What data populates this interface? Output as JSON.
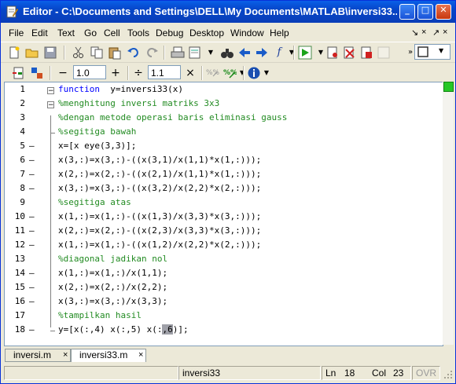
{
  "window": {
    "title": "Editor - C:\\Documents and Settings\\DELL\\My Documents\\MATLAB\\inversi33...",
    "minimize_glyph": "_",
    "maximize_glyph": "□",
    "close_glyph": "✕"
  },
  "menubar": {
    "items": [
      "File",
      "Edit",
      "Text",
      "Go",
      "Cell",
      "Tools",
      "Debug",
      "Desktop",
      "Window",
      "Help"
    ],
    "right_icons": [
      "↘",
      "×",
      "↗",
      "×"
    ]
  },
  "toolbar2": {
    "minus": "−",
    "plus": "+",
    "divide": "÷",
    "times": "×",
    "input1": "1.0",
    "input2": "1.1"
  },
  "code": {
    "lines": [
      {
        "n": "1",
        "dash": "",
        "parts": [
          [
            "kw",
            "function"
          ],
          [
            "",
            "  y=inversi33(x)"
          ]
        ]
      },
      {
        "n": "2",
        "dash": "",
        "parts": [
          [
            "cm",
            "%menghitung inversi matriks 3x3"
          ]
        ]
      },
      {
        "n": "3",
        "dash": "",
        "parts": [
          [
            "cm",
            "%dengan metode operasi baris eliminasi gauss"
          ]
        ]
      },
      {
        "n": "4",
        "dash": "",
        "parts": [
          [
            "cm",
            "%segitiga bawah"
          ]
        ]
      },
      {
        "n": "5",
        "dash": "–",
        "parts": [
          [
            "",
            "x=[x eye(3,3)];"
          ]
        ]
      },
      {
        "n": "6",
        "dash": "–",
        "parts": [
          [
            "",
            "x(3,:)=x(3,:)-((x(3,1)/x(1,1)*x(1,:)));"
          ]
        ]
      },
      {
        "n": "7",
        "dash": "–",
        "parts": [
          [
            "",
            "x(2,:)=x(2,:)-((x(2,1)/x(1,1)*x(1,:)));"
          ]
        ]
      },
      {
        "n": "8",
        "dash": "–",
        "parts": [
          [
            "",
            "x(3,:)=x(3,:)-((x(3,2)/x(2,2)*x(2,:)));"
          ]
        ]
      },
      {
        "n": "9",
        "dash": "",
        "parts": [
          [
            "cm",
            "%segitiga atas"
          ]
        ]
      },
      {
        "n": "10",
        "dash": "–",
        "parts": [
          [
            "",
            "x(1,:)=x(1,:)-((x(1,3)/x(3,3)*x(3,:)));"
          ]
        ]
      },
      {
        "n": "11",
        "dash": "–",
        "parts": [
          [
            "",
            "x(2,:)=x(2,:)-((x(2,3)/x(3,3)*x(3,:)));"
          ]
        ]
      },
      {
        "n": "12",
        "dash": "–",
        "parts": [
          [
            "",
            "x(1,:)=x(1,:)-((x(1,2)/x(2,2)*x(2,:)));"
          ]
        ]
      },
      {
        "n": "13",
        "dash": "",
        "parts": [
          [
            "cm",
            "%diagonal jadikan nol"
          ]
        ]
      },
      {
        "n": "14",
        "dash": "–",
        "parts": [
          [
            "",
            "x(1,:)=x(1,:)/x(1,1);"
          ]
        ]
      },
      {
        "n": "15",
        "dash": "–",
        "parts": [
          [
            "",
            "x(2,:)=x(2,:)/x(2,2);"
          ]
        ]
      },
      {
        "n": "16",
        "dash": "–",
        "parts": [
          [
            "",
            "x(3,:)=x(3,:)/x(3,3);"
          ]
        ]
      },
      {
        "n": "17",
        "dash": "",
        "parts": [
          [
            "cm",
            "%tampilkan hasil"
          ]
        ]
      },
      {
        "n": "18",
        "dash": "–",
        "parts": [
          [
            "",
            "y=[x(:,4) x(:,5) x(:"
          ],
          [
            "hl",
            ",6"
          ],
          [
            "",
            ")];"
          ]
        ]
      }
    ]
  },
  "tabs": [
    {
      "label": "inversi.m",
      "close": "×",
      "active": false
    },
    {
      "label": "inversi33.m",
      "close": "×",
      "active": true
    }
  ],
  "status": {
    "function_name": "inversi33",
    "ln_label": "Ln",
    "ln_value": "18",
    "col_label": "Col",
    "col_value": "23",
    "ovr": "OVR"
  }
}
